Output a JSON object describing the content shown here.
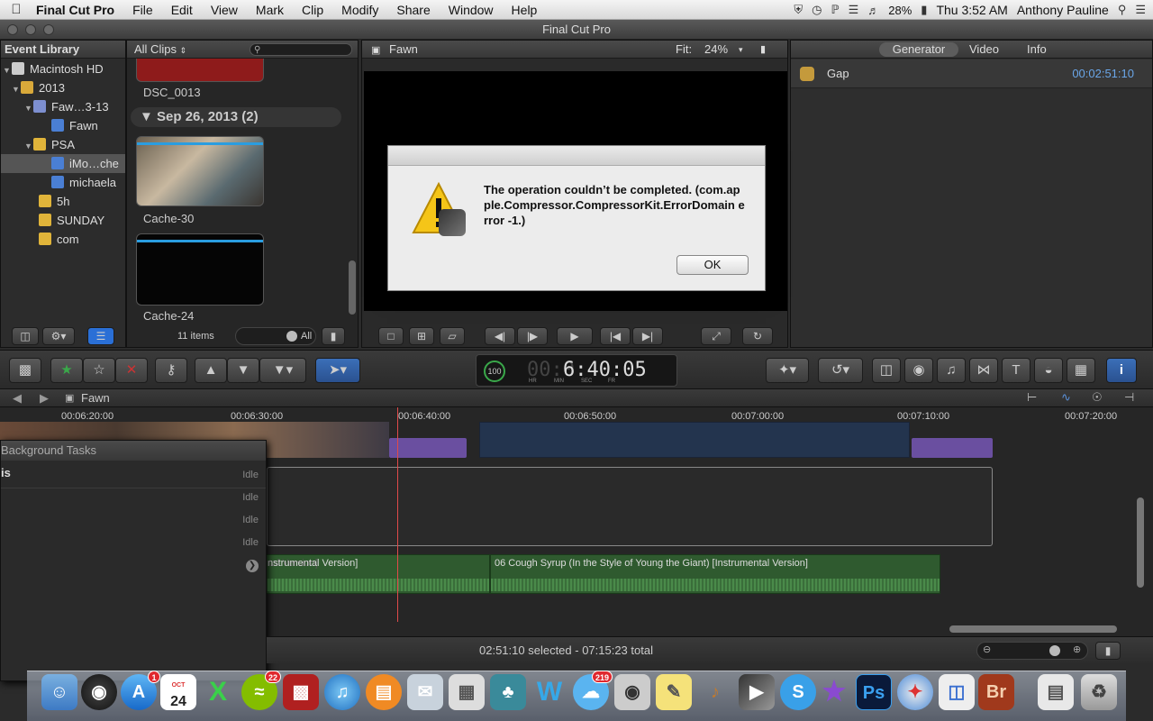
{
  "menubar": {
    "app_name": "Final Cut Pro",
    "items": [
      "File",
      "Edit",
      "View",
      "Mark",
      "Clip",
      "Modify",
      "Share",
      "Window",
      "Help"
    ],
    "battery": "28%",
    "clock": "Thu 3:52 AM",
    "user": "Anthony Pauline"
  },
  "window": {
    "title": "Final Cut Pro"
  },
  "library": {
    "header": "Event Library",
    "rows": [
      "Macintosh HD",
      "2013",
      "Faw…3-13",
      "Fawn",
      "PSA",
      "iMo…che",
      "michaela",
      "5h",
      "SUNDAY",
      "com"
    ],
    "items_count": "11 items",
    "filter_all": "All"
  },
  "browser": {
    "filter": "All Clips",
    "clip1": "DSC_0013",
    "date_header": "Sep 26, 2013",
    "date_count": "(2)",
    "clip2": "Cache-30",
    "clip3": "Cache-24"
  },
  "viewer": {
    "title": "Fawn",
    "fit_label": "Fit:",
    "fit_value": "24%"
  },
  "inspector": {
    "tabs": [
      "Generator",
      "Video",
      "Info"
    ],
    "item_name": "Gap",
    "item_duration": "00:02:51:10"
  },
  "dialog": {
    "message": "The operation couldn’t be completed. (com.apple.Compressor.CompressorKit.ErrorDomain error -1.)",
    "ok_label": "OK"
  },
  "dashboard": {
    "percent": "100",
    "percent_unit": "%",
    "timecode": "6:40:05",
    "timecode_dim": "00:0",
    "units": [
      "HR",
      "MIN",
      "SEC",
      "FR"
    ]
  },
  "timeline": {
    "project": "Fawn",
    "ruler": [
      "00:06:20:00",
      "00:06:30:00",
      "00:06:40:00",
      "00:06:50:00",
      "00:07:00:00",
      "00:07:10:00",
      "00:07:20:00"
    ],
    "audio_clip_1": "06 Cough Syrup (In the Style of Young the Giant) [Instrumental Version]",
    "audio_clip_1_tail": "nstrumental Version]",
    "audio_clip_2": "06 Cough Syrup (In the Style of Young the Giant) [Instrumental Version]",
    "status": "02:51:10 selected - 07:15:23 total"
  },
  "background_tasks": {
    "title": "Background Tasks",
    "first_label": "is",
    "states": [
      "Idle",
      "Idle",
      "Idle",
      "Idle"
    ]
  },
  "dock": {
    "calendar_month": "OCT",
    "calendar_day": "24",
    "badges": {
      "appstore": "1",
      "spotify": "22",
      "messages": "219"
    }
  },
  "colors": {
    "accent_blue": "#2a6fd6",
    "audio_green": "#2f5a2f",
    "playhead": "#e04a4a"
  }
}
